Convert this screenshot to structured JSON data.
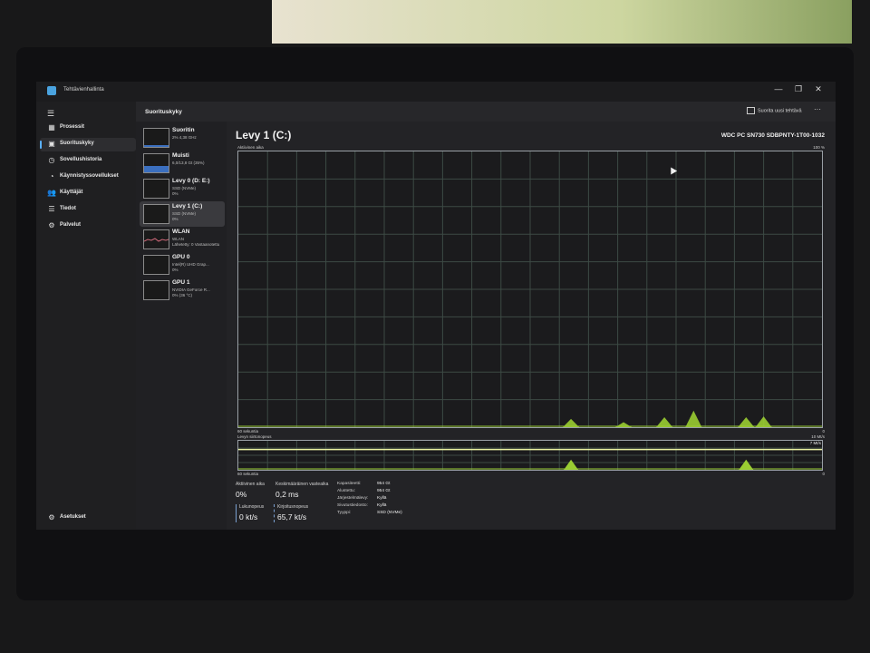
{
  "window": {
    "title": "Tehtävienhallinta",
    "controls": [
      "—",
      "❐",
      "✕"
    ]
  },
  "sidebar": {
    "items": [
      {
        "label": "Prosessit",
        "icon": "grid-icon"
      },
      {
        "label": "Suorituskyky",
        "icon": "performance-icon",
        "active": true
      },
      {
        "label": "Sovellushistoria",
        "icon": "history-icon"
      },
      {
        "label": "Käynnistyssovellukset",
        "icon": "startup-icon"
      },
      {
        "label": "Käyttäjät",
        "icon": "users-icon"
      },
      {
        "label": "Tiedot",
        "icon": "details-icon"
      },
      {
        "label": "Palvelut",
        "icon": "services-icon"
      }
    ],
    "settings": "Asetukset"
  },
  "header": {
    "title": "Suorituskyky",
    "run_task": "Suorita uusi tehtävä",
    "more": "···"
  },
  "devices": [
    {
      "name": "Suoritin",
      "sub1": "2% 4,38 GHz",
      "sub2": "",
      "kind": "cpu"
    },
    {
      "name": "Muisti",
      "sub1": "6,0/13,8 Gt (35%)",
      "sub2": "",
      "kind": "memory"
    },
    {
      "name": "Levy 0 (D: E:)",
      "sub1": "SSD (NVMe)",
      "sub2": "0%",
      "kind": "disk"
    },
    {
      "name": "Levy 1 (C:)",
      "sub1": "SSD (NVMe)",
      "sub2": "0%",
      "kind": "disk",
      "active": true
    },
    {
      "name": "WLAN",
      "sub1": "WLAN",
      "sub2": "Lähetetty: 0 Vastaanotettu",
      "kind": "wifi"
    },
    {
      "name": "GPU 0",
      "sub1": "Intel(R) UHD Grap...",
      "sub2": "0%",
      "kind": "gpu"
    },
    {
      "name": "GPU 1",
      "sub1": "NVIDIA GeForce R...",
      "sub2": "0% (36 °C)",
      "kind": "gpu"
    }
  ],
  "detail": {
    "title": "Levy 1 (C:)",
    "model": "WDC PC SN730 SDBPNTY-1T00-1032",
    "active_time_label": "Aktiivinen aika",
    "active_max": "100 %",
    "seconds_label": "60 sekuntia",
    "zero": "0",
    "transfer_label": "Levyn siirtonopeus",
    "transfer_max": "10 Mt/s",
    "transfer_marker": "7 Mt/s",
    "active_spikes": [
      {
        "t": 0.57,
        "v": 1.0
      },
      {
        "t": 0.66,
        "v": 0.6
      },
      {
        "t": 0.73,
        "v": 1.2
      },
      {
        "t": 0.78,
        "v": 2.0
      },
      {
        "t": 0.87,
        "v": 1.2
      },
      {
        "t": 0.9,
        "v": 1.3
      }
    ],
    "transfer_spikes": [
      {
        "t": 0.57,
        "v": 0.35
      },
      {
        "t": 0.87,
        "v": 0.35
      }
    ],
    "transfer_line": 0.7
  },
  "stats": {
    "active_time": {
      "label": "Aktiivinen aika",
      "value": "0%"
    },
    "avg_response": {
      "label": "Keskimääräinen vasteaika",
      "value": "0,2 ms"
    },
    "read_speed": {
      "label": "Lukunopeus",
      "value": "0 kt/s"
    },
    "write_speed": {
      "label": "Kirjoitusnopeus",
      "value": "65,7 kt/s"
    }
  },
  "properties": [
    {
      "key": "Kapasiteetti:",
      "value": "954 Gt"
    },
    {
      "key": "Alustettu:",
      "value": "954 Gt"
    },
    {
      "key": "Järjestelmälevy:",
      "value": "Kyllä"
    },
    {
      "key": "Sivutustiedosto:",
      "value": "Kyllä"
    },
    {
      "key": "Tyyppi:",
      "value": "SSD (NVMe)"
    }
  ],
  "colors": {
    "accent_blue": "#5ab0ff",
    "disk_green": "#9acd32",
    "grid": "#3c4a44"
  }
}
